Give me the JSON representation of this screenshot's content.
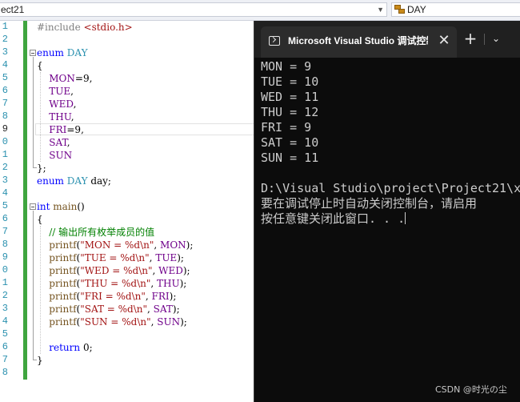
{
  "navbar": {
    "project_dropdown": "ect21",
    "symbol_dropdown": "DAY"
  },
  "editor": {
    "current_line": "9",
    "lines": [
      {
        "n": "1",
        "tokens": [
          [
            "pp",
            "#include "
          ],
          [
            "inc",
            "<stdio.h>"
          ]
        ]
      },
      {
        "n": "2",
        "tokens": []
      },
      {
        "n": "3",
        "tokens": [
          [
            "kw",
            "enum "
          ],
          [
            "ty",
            "DAY"
          ]
        ]
      },
      {
        "n": "4",
        "tokens": [
          [
            "pl",
            "{"
          ]
        ]
      },
      {
        "n": "5",
        "tokens": [
          [
            "pl",
            "    "
          ],
          [
            "en",
            "MON"
          ],
          [
            "pl",
            "=9,"
          ]
        ]
      },
      {
        "n": "6",
        "tokens": [
          [
            "pl",
            "    "
          ],
          [
            "en",
            "TUE"
          ],
          [
            "pl",
            ","
          ]
        ]
      },
      {
        "n": "7",
        "tokens": [
          [
            "pl",
            "    "
          ],
          [
            "en",
            "WED"
          ],
          [
            "pl",
            ","
          ]
        ]
      },
      {
        "n": "8",
        "tokens": [
          [
            "pl",
            "    "
          ],
          [
            "en",
            "THU"
          ],
          [
            "pl",
            ","
          ]
        ]
      },
      {
        "n": "9",
        "tokens": [
          [
            "pl",
            "    "
          ],
          [
            "en",
            "FRI"
          ],
          [
            "pl",
            "=9,"
          ]
        ]
      },
      {
        "n": "0",
        "tokens": [
          [
            "pl",
            "    "
          ],
          [
            "en",
            "SAT"
          ],
          [
            "pl",
            ","
          ]
        ]
      },
      {
        "n": "1",
        "tokens": [
          [
            "pl",
            "    "
          ],
          [
            "en",
            "SUN"
          ]
        ]
      },
      {
        "n": "2",
        "tokens": [
          [
            "pl",
            "};"
          ]
        ]
      },
      {
        "n": "3",
        "tokens": [
          [
            "kw",
            "enum "
          ],
          [
            "ty",
            "DAY"
          ],
          [
            "pl",
            " day;"
          ]
        ]
      },
      {
        "n": "4",
        "tokens": []
      },
      {
        "n": "5",
        "tokens": [
          [
            "kw",
            "int "
          ],
          [
            "fn",
            "main"
          ],
          [
            "pl",
            "()"
          ]
        ]
      },
      {
        "n": "6",
        "tokens": [
          [
            "pl",
            "{"
          ]
        ]
      },
      {
        "n": "7",
        "tokens": [
          [
            "pl",
            "    "
          ],
          [
            "cm",
            "// 输出所有枚举成员的值"
          ]
        ]
      },
      {
        "n": "8",
        "tokens": [
          [
            "pl",
            "    "
          ],
          [
            "fn",
            "printf"
          ],
          [
            "pl",
            "("
          ],
          [
            "st",
            "\"MON = %d\\n\""
          ],
          [
            "pl",
            ", "
          ],
          [
            "en",
            "MON"
          ],
          [
            "pl",
            ");"
          ]
        ]
      },
      {
        "n": "9",
        "tokens": [
          [
            "pl",
            "    "
          ],
          [
            "fn",
            "printf"
          ],
          [
            "pl",
            "("
          ],
          [
            "st",
            "\"TUE = %d\\n\""
          ],
          [
            "pl",
            ", "
          ],
          [
            "en",
            "TUE"
          ],
          [
            "pl",
            ");"
          ]
        ]
      },
      {
        "n": "0",
        "tokens": [
          [
            "pl",
            "    "
          ],
          [
            "fn",
            "printf"
          ],
          [
            "pl",
            "("
          ],
          [
            "st",
            "\"WED = %d\\n\""
          ],
          [
            "pl",
            ", "
          ],
          [
            "en",
            "WED"
          ],
          [
            "pl",
            ");"
          ]
        ]
      },
      {
        "n": "1",
        "tokens": [
          [
            "pl",
            "    "
          ],
          [
            "fn",
            "printf"
          ],
          [
            "pl",
            "("
          ],
          [
            "st",
            "\"THU = %d\\n\""
          ],
          [
            "pl",
            ", "
          ],
          [
            "en",
            "THU"
          ],
          [
            "pl",
            ");"
          ]
        ]
      },
      {
        "n": "2",
        "tokens": [
          [
            "pl",
            "    "
          ],
          [
            "fn",
            "printf"
          ],
          [
            "pl",
            "("
          ],
          [
            "st",
            "\"FRI = %d\\n\""
          ],
          [
            "pl",
            ", "
          ],
          [
            "en",
            "FRI"
          ],
          [
            "pl",
            ");"
          ]
        ]
      },
      {
        "n": "3",
        "tokens": [
          [
            "pl",
            "    "
          ],
          [
            "fn",
            "printf"
          ],
          [
            "pl",
            "("
          ],
          [
            "st",
            "\"SAT = %d\\n\""
          ],
          [
            "pl",
            ", "
          ],
          [
            "en",
            "SAT"
          ],
          [
            "pl",
            ");"
          ]
        ]
      },
      {
        "n": "4",
        "tokens": [
          [
            "pl",
            "    "
          ],
          [
            "fn",
            "printf"
          ],
          [
            "pl",
            "("
          ],
          [
            "st",
            "\"SUN = %d\\n\""
          ],
          [
            "pl",
            ", "
          ],
          [
            "en",
            "SUN"
          ],
          [
            "pl",
            ");"
          ]
        ]
      },
      {
        "n": "5",
        "tokens": []
      },
      {
        "n": "6",
        "tokens": [
          [
            "pl",
            "    "
          ],
          [
            "kw",
            "return"
          ],
          [
            "pl",
            " 0;"
          ]
        ]
      },
      {
        "n": "7",
        "tokens": [
          [
            "pl",
            "}"
          ]
        ]
      },
      {
        "n": "8",
        "tokens": []
      }
    ]
  },
  "terminal": {
    "tab_title": "Microsoft Visual Studio 调试控制台",
    "close_symbol": "✕",
    "new_tab_symbol": "+",
    "dropdown_symbol": "⌄",
    "output": [
      "MON = 9",
      "TUE = 10",
      "WED = 11",
      "THU = 12",
      "FRI = 9",
      "SAT = 10",
      "SUN = 11",
      "",
      "D:\\Visual Studio\\project\\Project21\\x",
      "要在调试停止时自动关闭控制台，请启用",
      "按任意键关闭此窗口. . ."
    ]
  },
  "watermark": "CSDN @时光の尘",
  "colors": {
    "keyword": "#0000ff",
    "type": "#2b91af",
    "enum_member": "#6f008a",
    "string": "#a31515",
    "comment": "#008000",
    "function": "#74531f",
    "change_bar": "#3fa53f",
    "terminal_bg": "#0c0c0c"
  }
}
